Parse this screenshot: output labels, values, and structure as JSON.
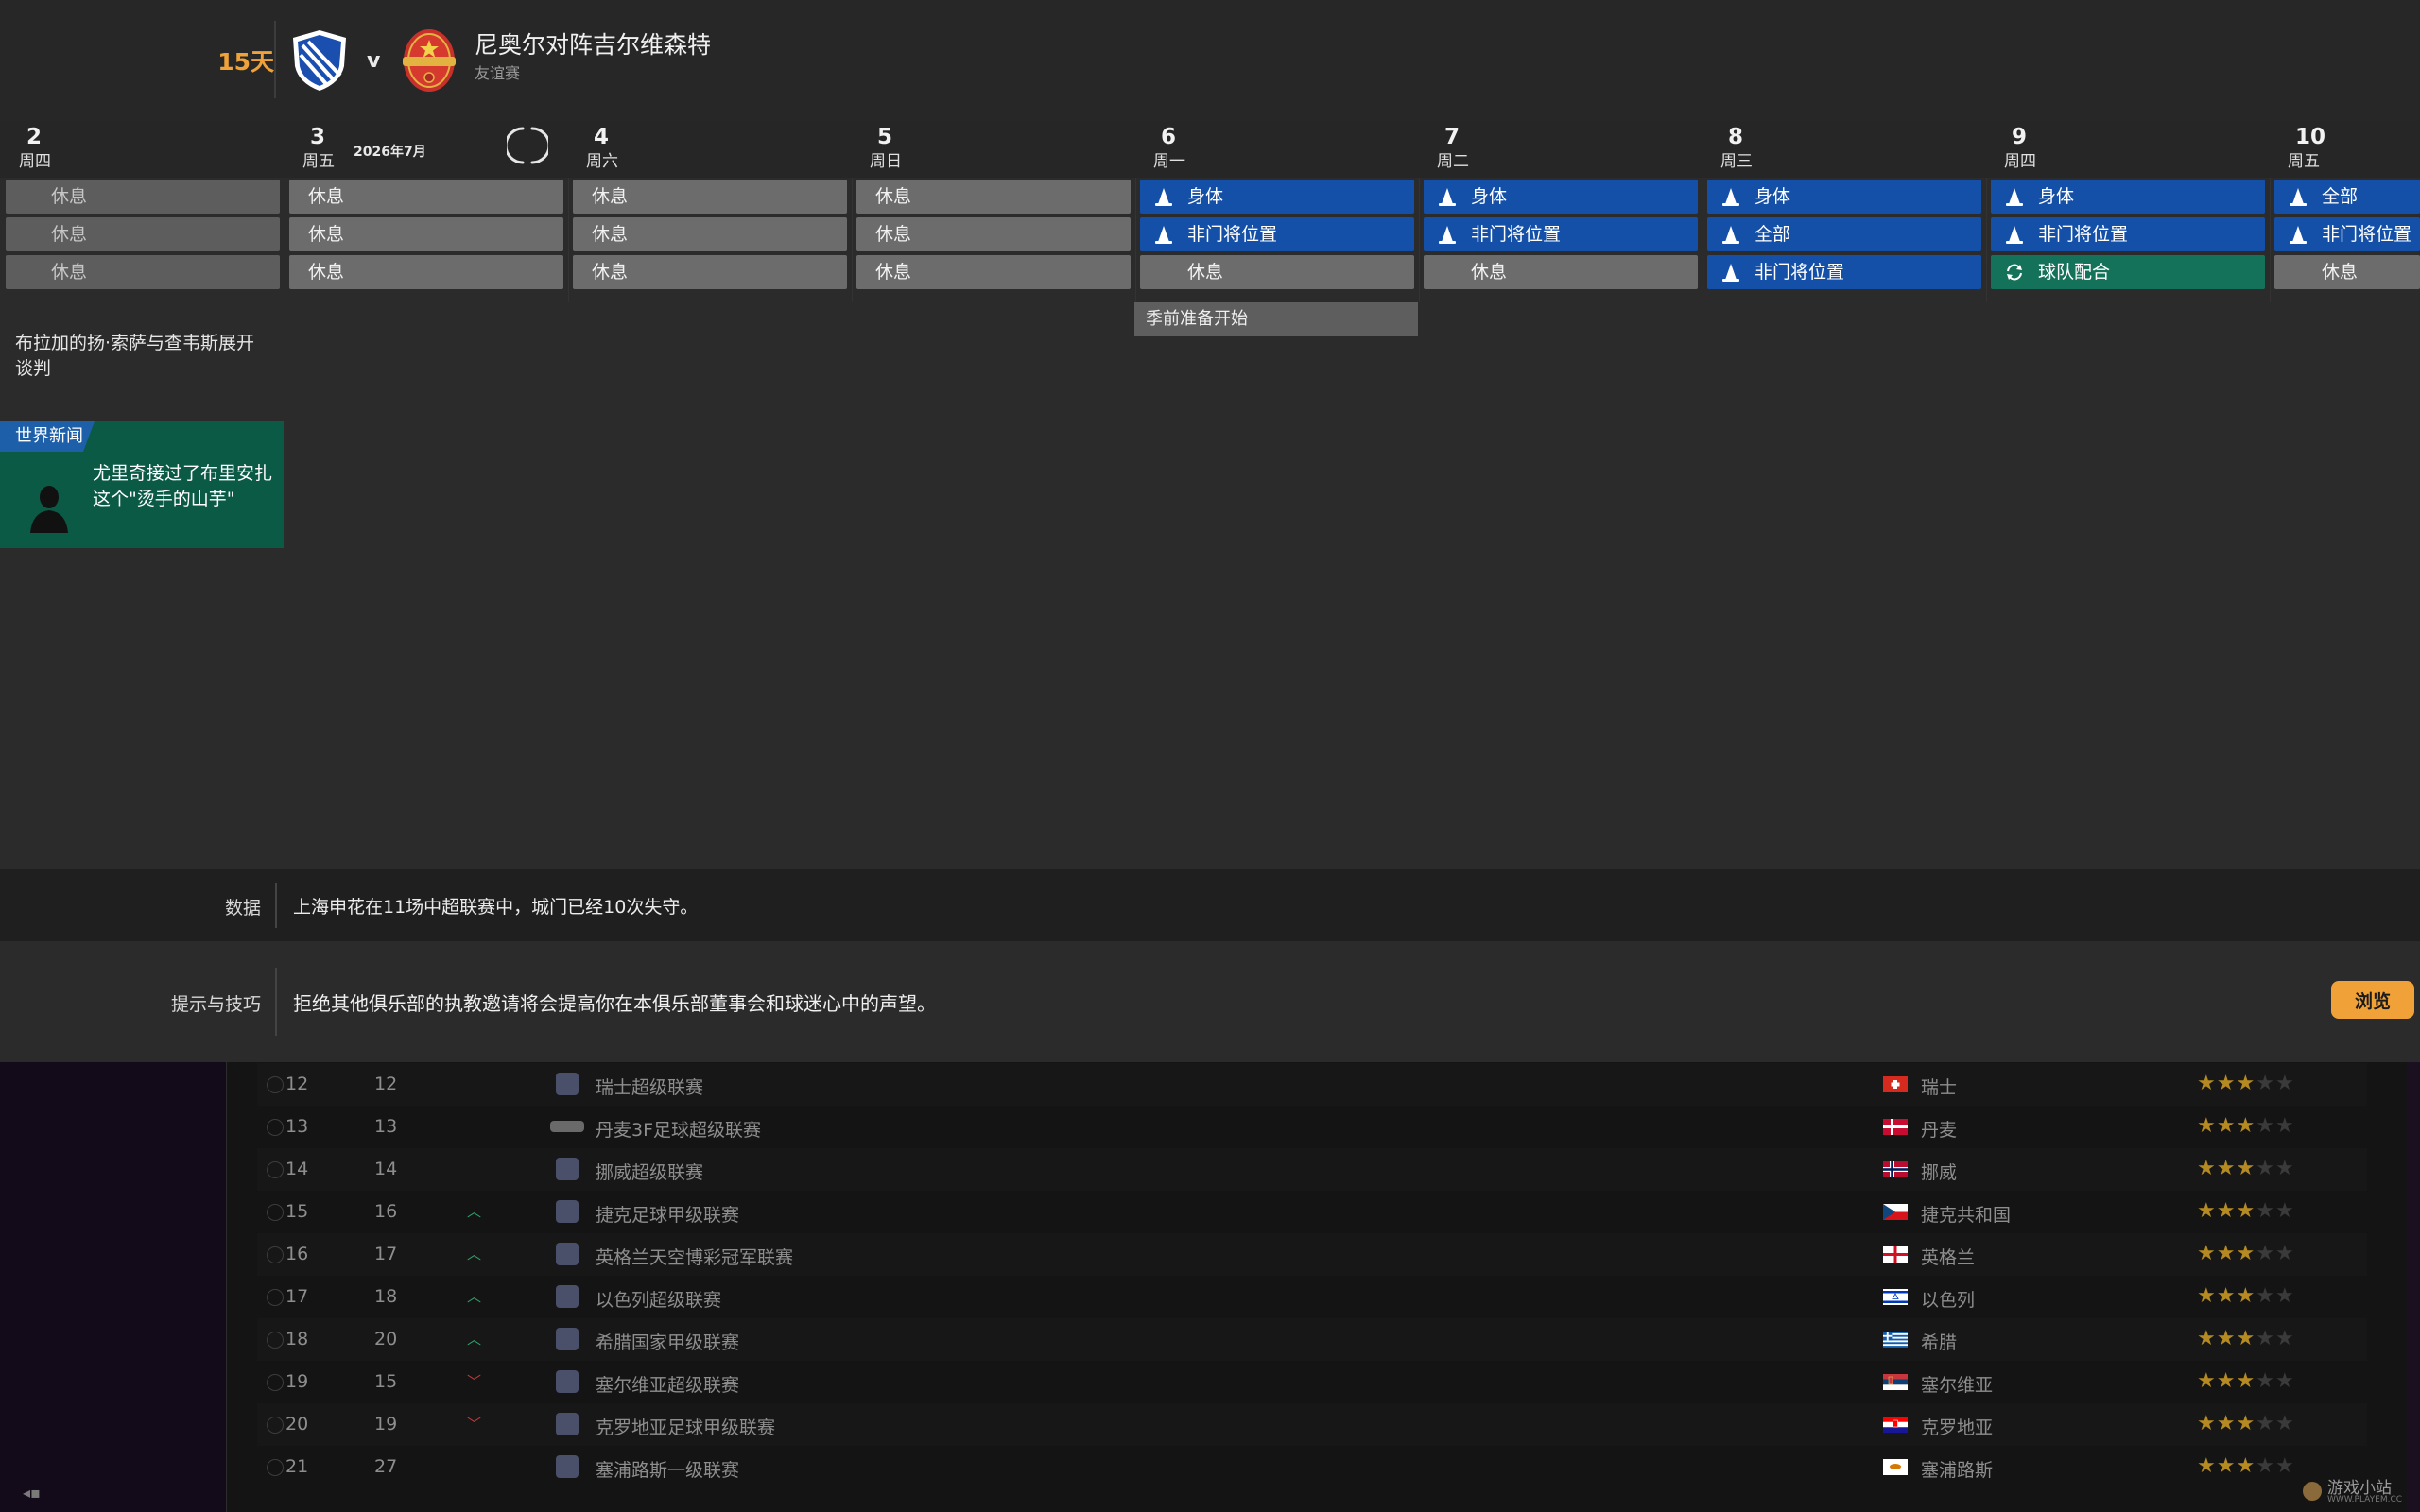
{
  "header": {
    "days_left": "15天",
    "vs": "v",
    "match_title": "尼奥尔对阵吉尔维森特",
    "match_type": "友谊赛"
  },
  "calendar": {
    "month_label": "2026年7月",
    "days": [
      {
        "num": "2",
        "name": "周四",
        "sessions": [
          {
            "label": "休息",
            "kind": "rest-dim",
            "icon": ""
          },
          {
            "label": "休息",
            "kind": "rest-dim",
            "icon": ""
          },
          {
            "label": "休息",
            "kind": "rest-dim",
            "icon": ""
          }
        ]
      },
      {
        "num": "3",
        "name": "周五",
        "sessions": [
          {
            "label": "休息",
            "kind": "rest",
            "icon": ""
          },
          {
            "label": "休息",
            "kind": "rest",
            "icon": ""
          },
          {
            "label": "休息",
            "kind": "rest",
            "icon": ""
          }
        ]
      },
      {
        "num": "4",
        "name": "周六",
        "sessions": [
          {
            "label": "休息",
            "kind": "rest",
            "icon": ""
          },
          {
            "label": "休息",
            "kind": "rest",
            "icon": ""
          },
          {
            "label": "休息",
            "kind": "rest",
            "icon": ""
          }
        ]
      },
      {
        "num": "5",
        "name": "周日",
        "sessions": [
          {
            "label": "休息",
            "kind": "rest",
            "icon": ""
          },
          {
            "label": "休息",
            "kind": "rest",
            "icon": ""
          },
          {
            "label": "休息",
            "kind": "rest",
            "icon": ""
          }
        ]
      },
      {
        "num": "6",
        "name": "周一",
        "sessions": [
          {
            "label": "身体",
            "kind": "blue",
            "icon": "training-cone-icon"
          },
          {
            "label": "非门将位置",
            "kind": "blue",
            "icon": "training-cone-icon"
          },
          {
            "label": "休息",
            "kind": "rest-pad",
            "icon": ""
          }
        ]
      },
      {
        "num": "7",
        "name": "周二",
        "sessions": [
          {
            "label": "身体",
            "kind": "blue",
            "icon": "training-cone-icon"
          },
          {
            "label": "非门将位置",
            "kind": "blue",
            "icon": "training-cone-icon"
          },
          {
            "label": "休息",
            "kind": "rest-pad",
            "icon": ""
          }
        ]
      },
      {
        "num": "8",
        "name": "周三",
        "sessions": [
          {
            "label": "身体",
            "kind": "blue",
            "icon": "training-cone-icon"
          },
          {
            "label": "全部",
            "kind": "blue",
            "icon": "training-cone-icon"
          },
          {
            "label": "非门将位置",
            "kind": "blue",
            "icon": "training-cone-icon"
          }
        ]
      },
      {
        "num": "9",
        "name": "周四",
        "sessions": [
          {
            "label": "身体",
            "kind": "blue",
            "icon": "training-cone-icon"
          },
          {
            "label": "非门将位置",
            "kind": "blue",
            "icon": "training-cone-icon"
          },
          {
            "label": "球队配合",
            "kind": "green",
            "icon": "team-rotate-icon"
          }
        ]
      },
      {
        "num": "10",
        "name": "周五",
        "sessions": [
          {
            "label": "全部",
            "kind": "blue",
            "icon": "training-cone-icon"
          },
          {
            "label": "非门将位置",
            "kind": "blue",
            "icon": "training-cone-icon"
          },
          {
            "label": "休息",
            "kind": "rest-pad",
            "icon": ""
          }
        ]
      }
    ],
    "preseason_label": "季前准备开始",
    "news_text": "布拉加的扬·索萨与查韦斯展开谈判",
    "world_news": {
      "tag": "世界新闻",
      "text": "尤里奇接过了布里安扎这个\"烫手的山芋\""
    }
  },
  "stats_bar": {
    "label": "数据",
    "text": "上海申花在11场中超联赛中，城门已经10次失守。"
  },
  "tips_bar": {
    "label": "提示与技巧",
    "text": "拒绝其他俱乐部的执教邀请将会提高你在本俱乐部董事会和球迷心中的声望。",
    "button": "浏览"
  },
  "league_table": {
    "rows": [
      {
        "pos": "12",
        "prev": "12",
        "trend": "",
        "league": "瑞士超级联赛",
        "country": "瑞士",
        "stars": 3.5,
        "flag": "ch"
      },
      {
        "pos": "13",
        "prev": "13",
        "trend": "",
        "league": "丹麦3F足球超级联赛",
        "country": "丹麦",
        "stars": 3,
        "flag": "dk"
      },
      {
        "pos": "14",
        "prev": "14",
        "trend": "",
        "league": "挪威超级联赛",
        "country": "挪威",
        "stars": 3,
        "flag": "no"
      },
      {
        "pos": "15",
        "prev": "16",
        "trend": "up",
        "league": "捷克足球甲级联赛",
        "country": "捷克共和国",
        "stars": 3,
        "flag": "cz"
      },
      {
        "pos": "16",
        "prev": "17",
        "trend": "up",
        "league": "英格兰天空博彩冠军联赛",
        "country": "英格兰",
        "stars": 3,
        "flag": "en"
      },
      {
        "pos": "17",
        "prev": "18",
        "trend": "up",
        "league": "以色列超级联赛",
        "country": "以色列",
        "stars": 3,
        "flag": "il"
      },
      {
        "pos": "18",
        "prev": "20",
        "trend": "up",
        "league": "希腊国家甲级联赛",
        "country": "希腊",
        "stars": 3,
        "flag": "gr"
      },
      {
        "pos": "19",
        "prev": "15",
        "trend": "down",
        "league": "塞尔维亚超级联赛",
        "country": "塞尔维亚",
        "stars": 3,
        "flag": "rs"
      },
      {
        "pos": "20",
        "prev": "19",
        "trend": "down",
        "league": "克罗地亚足球甲级联赛",
        "country": "克罗地亚",
        "stars": 3,
        "flag": "hr"
      },
      {
        "pos": "21",
        "prev": "27",
        "trend": "",
        "league": "塞浦路斯一级联赛",
        "country": "塞浦路斯",
        "stars": 3,
        "flag": "cy"
      }
    ]
  },
  "watermark": {
    "main": "游戏小站",
    "sub": "WWW.PLAYEM.CC"
  },
  "colors": {
    "accent": "#f0a238",
    "training_blue": "#1550a8",
    "team_green": "#14725a",
    "rest_gray": "#6c6c6c"
  }
}
